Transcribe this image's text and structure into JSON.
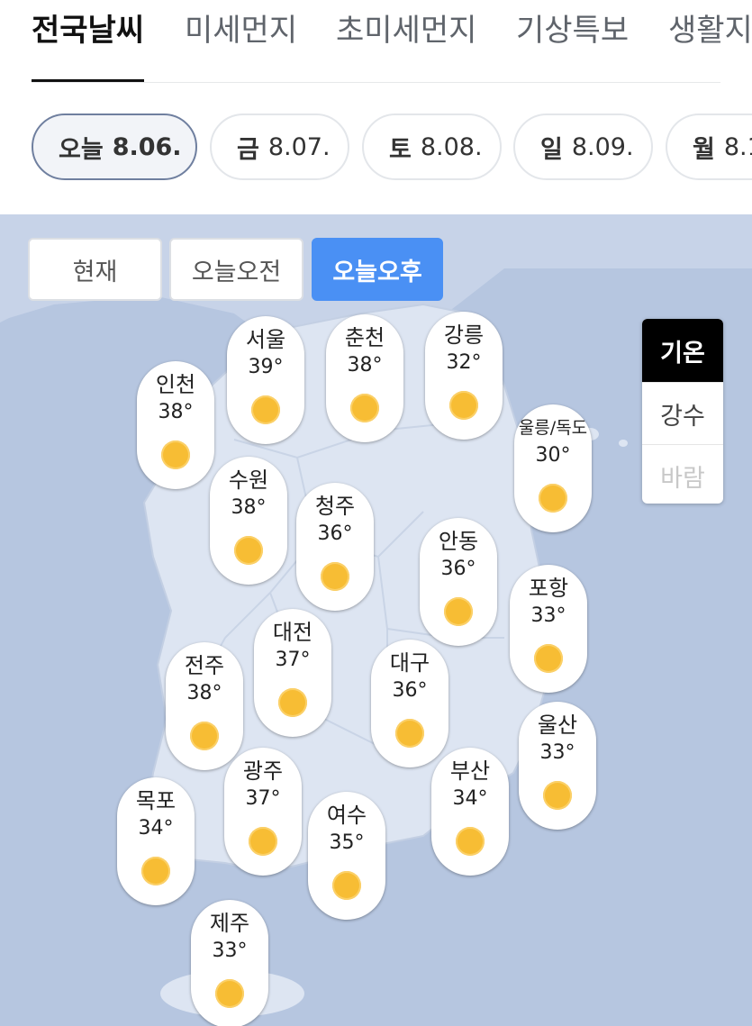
{
  "tabs": [
    "전국날씨",
    "미세먼지",
    "초미세먼지",
    "기상특보",
    "생활지"
  ],
  "dates": [
    {
      "day": "오늘",
      "date": "8.06."
    },
    {
      "day": "금",
      "date": "8.07."
    },
    {
      "day": "토",
      "date": "8.08."
    },
    {
      "day": "일",
      "date": "8.09."
    },
    {
      "day": "월",
      "date": "8.1"
    }
  ],
  "time_filters": [
    "현재",
    "오늘오전",
    "오늘오후"
  ],
  "side_menu": [
    "기온",
    "강수",
    "바람"
  ],
  "degree_symbol": "°",
  "weather_icon": "sun-icon",
  "colors": {
    "active_time": "#4a90f4",
    "map_sea": "#b6c6e0",
    "map_land": "#dde5f2",
    "sun": "#f7bd34"
  },
  "cities": [
    {
      "name": "서울",
      "temp": "39"
    },
    {
      "name": "춘천",
      "temp": "38"
    },
    {
      "name": "강릉",
      "temp": "32"
    },
    {
      "name": "인천",
      "temp": "38"
    },
    {
      "name": "울릉/독도",
      "temp": "30"
    },
    {
      "name": "수원",
      "temp": "38"
    },
    {
      "name": "청주",
      "temp": "36"
    },
    {
      "name": "안동",
      "temp": "36"
    },
    {
      "name": "포항",
      "temp": "33"
    },
    {
      "name": "대전",
      "temp": "37"
    },
    {
      "name": "전주",
      "temp": "38"
    },
    {
      "name": "대구",
      "temp": "36"
    },
    {
      "name": "울산",
      "temp": "33"
    },
    {
      "name": "광주",
      "temp": "37"
    },
    {
      "name": "부산",
      "temp": "34"
    },
    {
      "name": "목포",
      "temp": "34"
    },
    {
      "name": "여수",
      "temp": "35"
    },
    {
      "name": "제주",
      "temp": "33"
    }
  ]
}
